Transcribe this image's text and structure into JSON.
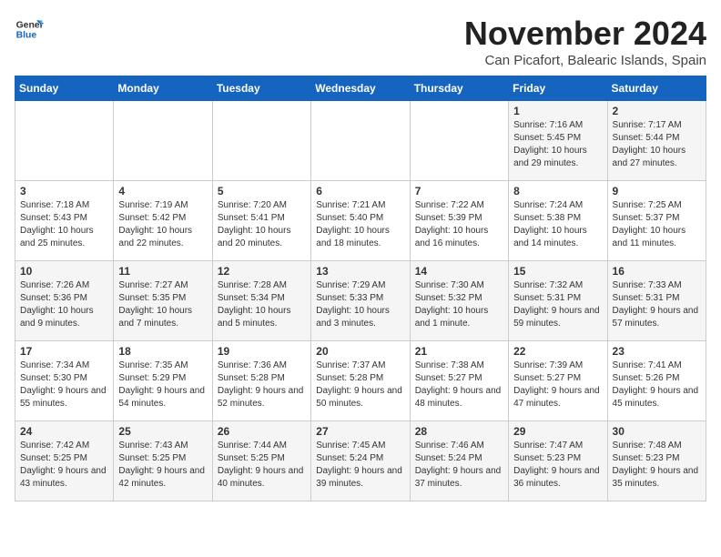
{
  "logo": {
    "general": "General",
    "blue": "Blue"
  },
  "header": {
    "month_year": "November 2024",
    "location": "Can Picafort, Balearic Islands, Spain"
  },
  "weekdays": [
    "Sunday",
    "Monday",
    "Tuesday",
    "Wednesday",
    "Thursday",
    "Friday",
    "Saturday"
  ],
  "weeks": [
    [
      {
        "day": "",
        "info": ""
      },
      {
        "day": "",
        "info": ""
      },
      {
        "day": "",
        "info": ""
      },
      {
        "day": "",
        "info": ""
      },
      {
        "day": "",
        "info": ""
      },
      {
        "day": "1",
        "info": "Sunrise: 7:16 AM\nSunset: 5:45 PM\nDaylight: 10 hours and 29 minutes."
      },
      {
        "day": "2",
        "info": "Sunrise: 7:17 AM\nSunset: 5:44 PM\nDaylight: 10 hours and 27 minutes."
      }
    ],
    [
      {
        "day": "3",
        "info": "Sunrise: 7:18 AM\nSunset: 5:43 PM\nDaylight: 10 hours and 25 minutes."
      },
      {
        "day": "4",
        "info": "Sunrise: 7:19 AM\nSunset: 5:42 PM\nDaylight: 10 hours and 22 minutes."
      },
      {
        "day": "5",
        "info": "Sunrise: 7:20 AM\nSunset: 5:41 PM\nDaylight: 10 hours and 20 minutes."
      },
      {
        "day": "6",
        "info": "Sunrise: 7:21 AM\nSunset: 5:40 PM\nDaylight: 10 hours and 18 minutes."
      },
      {
        "day": "7",
        "info": "Sunrise: 7:22 AM\nSunset: 5:39 PM\nDaylight: 10 hours and 16 minutes."
      },
      {
        "day": "8",
        "info": "Sunrise: 7:24 AM\nSunset: 5:38 PM\nDaylight: 10 hours and 14 minutes."
      },
      {
        "day": "9",
        "info": "Sunrise: 7:25 AM\nSunset: 5:37 PM\nDaylight: 10 hours and 11 minutes."
      }
    ],
    [
      {
        "day": "10",
        "info": "Sunrise: 7:26 AM\nSunset: 5:36 PM\nDaylight: 10 hours and 9 minutes."
      },
      {
        "day": "11",
        "info": "Sunrise: 7:27 AM\nSunset: 5:35 PM\nDaylight: 10 hours and 7 minutes."
      },
      {
        "day": "12",
        "info": "Sunrise: 7:28 AM\nSunset: 5:34 PM\nDaylight: 10 hours and 5 minutes."
      },
      {
        "day": "13",
        "info": "Sunrise: 7:29 AM\nSunset: 5:33 PM\nDaylight: 10 hours and 3 minutes."
      },
      {
        "day": "14",
        "info": "Sunrise: 7:30 AM\nSunset: 5:32 PM\nDaylight: 10 hours and 1 minute."
      },
      {
        "day": "15",
        "info": "Sunrise: 7:32 AM\nSunset: 5:31 PM\nDaylight: 9 hours and 59 minutes."
      },
      {
        "day": "16",
        "info": "Sunrise: 7:33 AM\nSunset: 5:31 PM\nDaylight: 9 hours and 57 minutes."
      }
    ],
    [
      {
        "day": "17",
        "info": "Sunrise: 7:34 AM\nSunset: 5:30 PM\nDaylight: 9 hours and 55 minutes."
      },
      {
        "day": "18",
        "info": "Sunrise: 7:35 AM\nSunset: 5:29 PM\nDaylight: 9 hours and 54 minutes."
      },
      {
        "day": "19",
        "info": "Sunrise: 7:36 AM\nSunset: 5:28 PM\nDaylight: 9 hours and 52 minutes."
      },
      {
        "day": "20",
        "info": "Sunrise: 7:37 AM\nSunset: 5:28 PM\nDaylight: 9 hours and 50 minutes."
      },
      {
        "day": "21",
        "info": "Sunrise: 7:38 AM\nSunset: 5:27 PM\nDaylight: 9 hours and 48 minutes."
      },
      {
        "day": "22",
        "info": "Sunrise: 7:39 AM\nSunset: 5:27 PM\nDaylight: 9 hours and 47 minutes."
      },
      {
        "day": "23",
        "info": "Sunrise: 7:41 AM\nSunset: 5:26 PM\nDaylight: 9 hours and 45 minutes."
      }
    ],
    [
      {
        "day": "24",
        "info": "Sunrise: 7:42 AM\nSunset: 5:25 PM\nDaylight: 9 hours and 43 minutes."
      },
      {
        "day": "25",
        "info": "Sunrise: 7:43 AM\nSunset: 5:25 PM\nDaylight: 9 hours and 42 minutes."
      },
      {
        "day": "26",
        "info": "Sunrise: 7:44 AM\nSunset: 5:25 PM\nDaylight: 9 hours and 40 minutes."
      },
      {
        "day": "27",
        "info": "Sunrise: 7:45 AM\nSunset: 5:24 PM\nDaylight: 9 hours and 39 minutes."
      },
      {
        "day": "28",
        "info": "Sunrise: 7:46 AM\nSunset: 5:24 PM\nDaylight: 9 hours and 37 minutes."
      },
      {
        "day": "29",
        "info": "Sunrise: 7:47 AM\nSunset: 5:23 PM\nDaylight: 9 hours and 36 minutes."
      },
      {
        "day": "30",
        "info": "Sunrise: 7:48 AM\nSunset: 5:23 PM\nDaylight: 9 hours and 35 minutes."
      }
    ]
  ]
}
